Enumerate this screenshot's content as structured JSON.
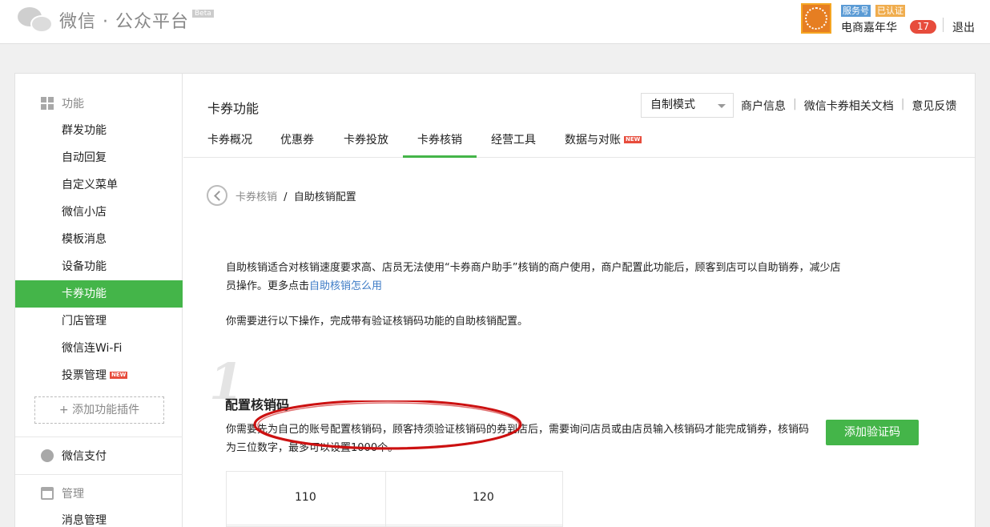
{
  "header": {
    "logo_title": "微信 · 公众平台",
    "beta": "Beta",
    "service_tag": "服务号",
    "verified_tag": "已认证",
    "account_name": "电商嘉年华",
    "message_count": "17",
    "logout": "退出"
  },
  "sidebar": {
    "sections": {
      "features": "功能",
      "wechat_pay": "微信支付",
      "manage": "管理"
    },
    "feature_items": [
      {
        "label": "群发功能"
      },
      {
        "label": "自动回复"
      },
      {
        "label": "自定义菜单"
      },
      {
        "label": "微信小店"
      },
      {
        "label": "模板消息"
      },
      {
        "label": "设备功能"
      },
      {
        "label": "卡券功能",
        "active": true
      },
      {
        "label": "门店管理"
      },
      {
        "label": "微信连Wi-Fi"
      },
      {
        "label": "投票管理",
        "badge": "NEW"
      }
    ],
    "add_plugin": "+ 添加功能插件",
    "manage_items": [
      {
        "label": "消息管理"
      }
    ]
  },
  "main": {
    "page_title": "卡券功能",
    "mode_select": "自制模式",
    "top_links": [
      "商户信息",
      "微信卡券相关文档",
      "意见反馈"
    ],
    "tabs": [
      {
        "label": "卡券概况"
      },
      {
        "label": "优惠券"
      },
      {
        "label": "卡券投放"
      },
      {
        "label": "卡券核销",
        "active": true
      },
      {
        "label": "经营工具"
      },
      {
        "label": "数据与对账",
        "badge": "NEW"
      }
    ],
    "breadcrumb": {
      "prev": "卡券核销",
      "sep": "/",
      "current": "自助核销配置"
    },
    "intro_text": "自助核销适合对核销速度要求高、店员无法使用“卡券商户助手”核销的商户使用，商户配置此功能后，顾客到店可以自助销券，减少店员操作。更多点击",
    "intro_link": "自助核销怎么用",
    "need_text": "你需要进行以下操作，完成带有验证核销码功能的自助核销配置。",
    "step": {
      "number": "1",
      "title": "配置核销码",
      "description": "你需要先为自己的账号配置核销码，顾客持须验证核销码的券到店后，需要询问店员或由店员输入核销码才能完成销券，核销码为三位数字，最多可以设置1000个。",
      "add_button": "添加验证码",
      "codes": [
        "110",
        "120"
      ]
    }
  },
  "colors": {
    "accent": "#44b549",
    "link": "#3d7bc6",
    "badge": "#e74c3c",
    "annotation": "#cc1111"
  }
}
